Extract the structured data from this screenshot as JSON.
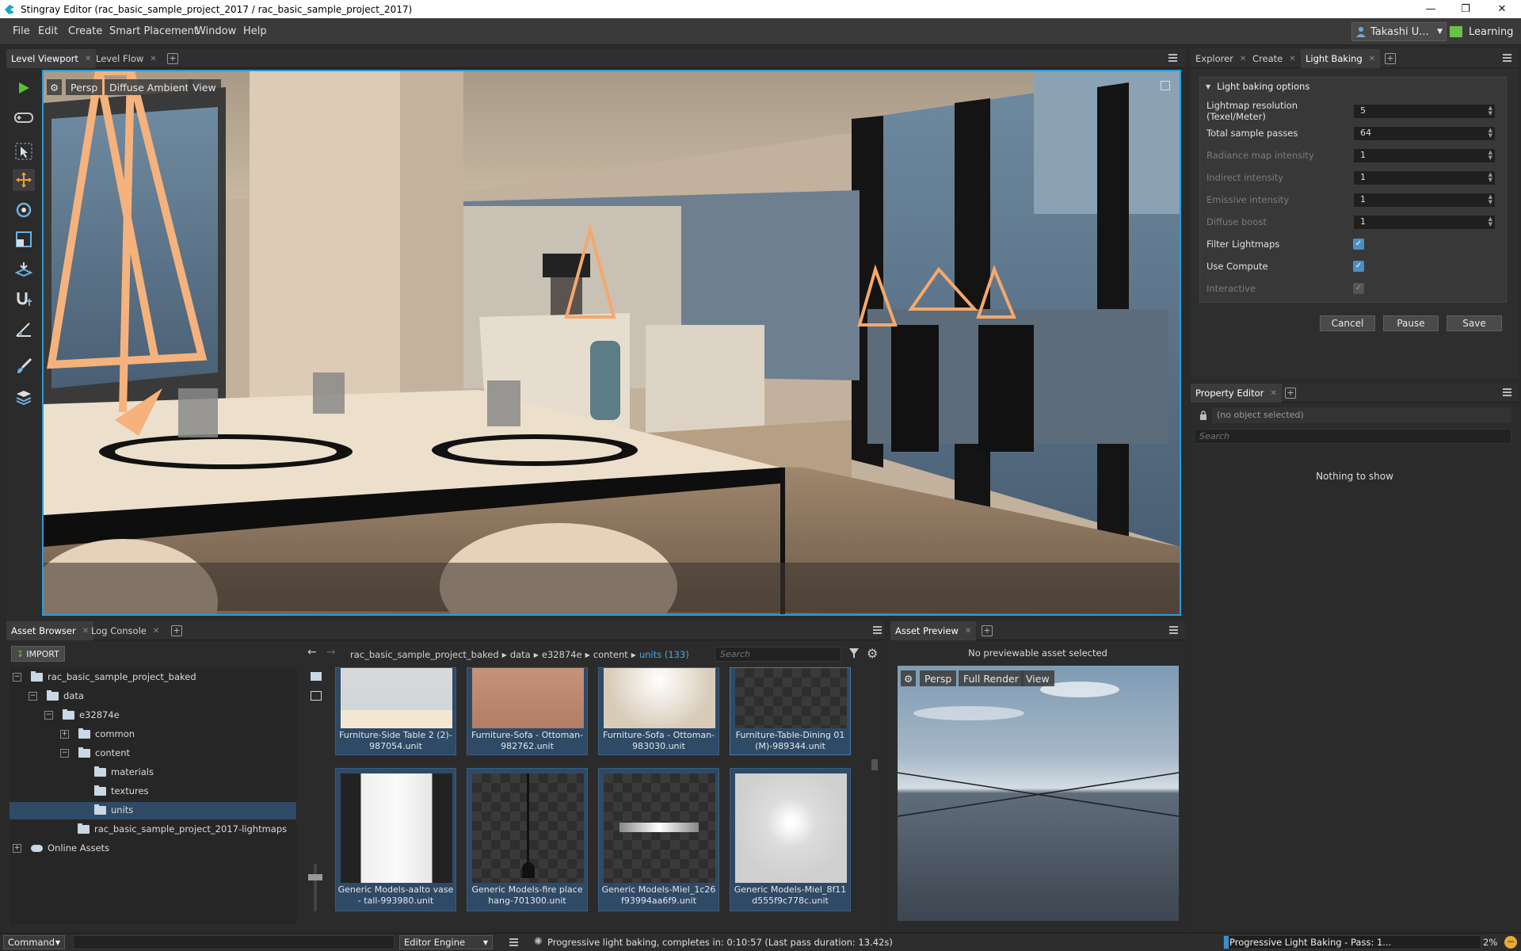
{
  "window": {
    "title": "Stingray Editor (rac_basic_sample_project_2017 / rac_basic_sample_project_2017)",
    "minimize": "—",
    "maximize": "❐",
    "close": "✕"
  },
  "menu": [
    "File",
    "Edit",
    "Create",
    "Smart Placement",
    "Window",
    "Help"
  ],
  "user": {
    "name": "Takashi U...",
    "learning": "Learning"
  },
  "main_tabs": [
    "Level Viewport",
    "Level Flow"
  ],
  "viewport": {
    "camera": "Persp",
    "mode": "Diffuse Ambient",
    "view": "View"
  },
  "right_tabs": [
    "Explorer",
    "Create",
    "Light Baking"
  ],
  "light_baking": {
    "section": "Light baking options",
    "fields": [
      {
        "label": "Lightmap resolution (Texel/Meter)",
        "value": "5",
        "enabled": true
      },
      {
        "label": "Total sample passes",
        "value": "64",
        "enabled": true
      },
      {
        "label": "Radiance map intensity",
        "value": "1",
        "enabled": false
      },
      {
        "label": "Indirect intensity",
        "value": "1",
        "enabled": false
      },
      {
        "label": "Emissive intensity",
        "value": "1",
        "enabled": false
      },
      {
        "label": "Diffuse boost",
        "value": "1",
        "enabled": false
      }
    ],
    "checks": [
      {
        "label": "Filter Lightmaps",
        "enabled": true
      },
      {
        "label": "Use Compute",
        "enabled": true
      },
      {
        "label": "Interactive",
        "enabled": false
      }
    ],
    "buttons": {
      "cancel": "Cancel",
      "pause": "Pause",
      "save": "Save"
    }
  },
  "property_editor": {
    "tab": "Property Editor",
    "selection": "(no object selected)",
    "search_placeholder": "Search",
    "empty": "Nothing to show"
  },
  "bottom_tabs": [
    "Asset Browser",
    "Log Console"
  ],
  "asset_browser": {
    "import": "IMPORT",
    "breadcrumb": [
      "rac_basic_sample_project_baked",
      "data",
      "e32874e",
      "content"
    ],
    "current": "units (133)",
    "search_placeholder": "Search",
    "tree": [
      "rac_basic_sample_project_baked",
      "data",
      "e32874e",
      "common",
      "content",
      "materials",
      "textures",
      "units",
      "rac_basic_sample_project_2017-lightmaps",
      "Online Assets"
    ],
    "assets_top": [
      "Furniture-Side Table 2 (2)-987054.unit",
      "Furniture-Sofa - Ottoman-982762.unit",
      "Furniture-Sofa - Ottoman-983030.unit",
      "Furniture-Table-Dining 01 (M)-989344.unit"
    ],
    "assets_bottom": [
      "Generic Models-aalto vase - tall-993980.unit",
      "Generic Models-fire place hang-701300.unit",
      "Generic Models-Miel_1c26f93994aa6f9.unit",
      "Generic Models-Miel_8f11d555f9c778c.unit"
    ]
  },
  "asset_preview": {
    "tab": "Asset Preview",
    "message": "No previewable asset selected",
    "camera": "Persp",
    "mode": "Full Render",
    "view": "View"
  },
  "status": {
    "command": "Command",
    "engine": "Editor Engine",
    "message": "Progressive light baking, completes in: 0:10:57 (Last pass duration: 13.42s)",
    "progress_label": "Progressive Light Baking - Pass: 1...",
    "percent": "2%",
    "progress": 0.02
  }
}
